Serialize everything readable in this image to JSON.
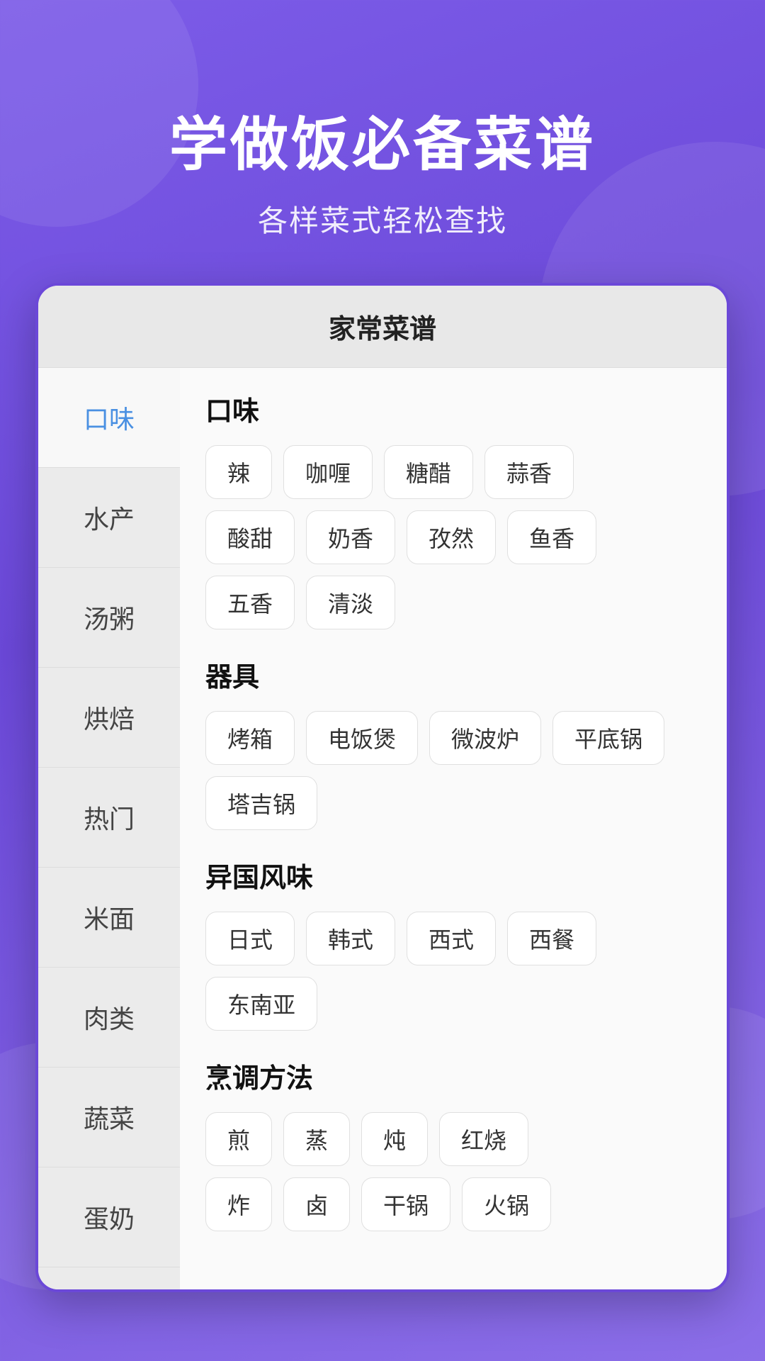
{
  "header": {
    "main_title": "学做饭必备菜谱",
    "sub_title": "各样菜式轻松查找"
  },
  "card": {
    "title": "家常菜谱"
  },
  "sidebar": {
    "items": [
      {
        "label": "口味",
        "active": true
      },
      {
        "label": "水产",
        "active": false
      },
      {
        "label": "汤粥",
        "active": false
      },
      {
        "label": "烘焙",
        "active": false
      },
      {
        "label": "热门",
        "active": false
      },
      {
        "label": "米面",
        "active": false
      },
      {
        "label": "肉类",
        "active": false
      },
      {
        "label": "蔬菜",
        "active": false
      },
      {
        "label": "蛋奶",
        "active": false
      }
    ]
  },
  "sections": [
    {
      "title": "口味",
      "tags": [
        [
          "辣",
          "咖喱",
          "糖醋",
          "蒜香"
        ],
        [
          "酸甜",
          "奶香",
          "孜然",
          "鱼香"
        ],
        [
          "五香",
          "清淡"
        ]
      ]
    },
    {
      "title": "器具",
      "tags": [
        [
          "烤箱",
          "电饭煲",
          "微波炉",
          "平底锅"
        ],
        [
          "塔吉锅"
        ]
      ]
    },
    {
      "title": "异国风味",
      "tags": [
        [
          "日式",
          "韩式",
          "西式",
          "西餐"
        ],
        [
          "东南亚"
        ]
      ]
    },
    {
      "title": "烹调方法",
      "tags": [
        [
          "煎",
          "蒸",
          "炖",
          "红烧"
        ],
        [
          "炸",
          "卤",
          "干锅",
          "火锅"
        ]
      ]
    }
  ]
}
